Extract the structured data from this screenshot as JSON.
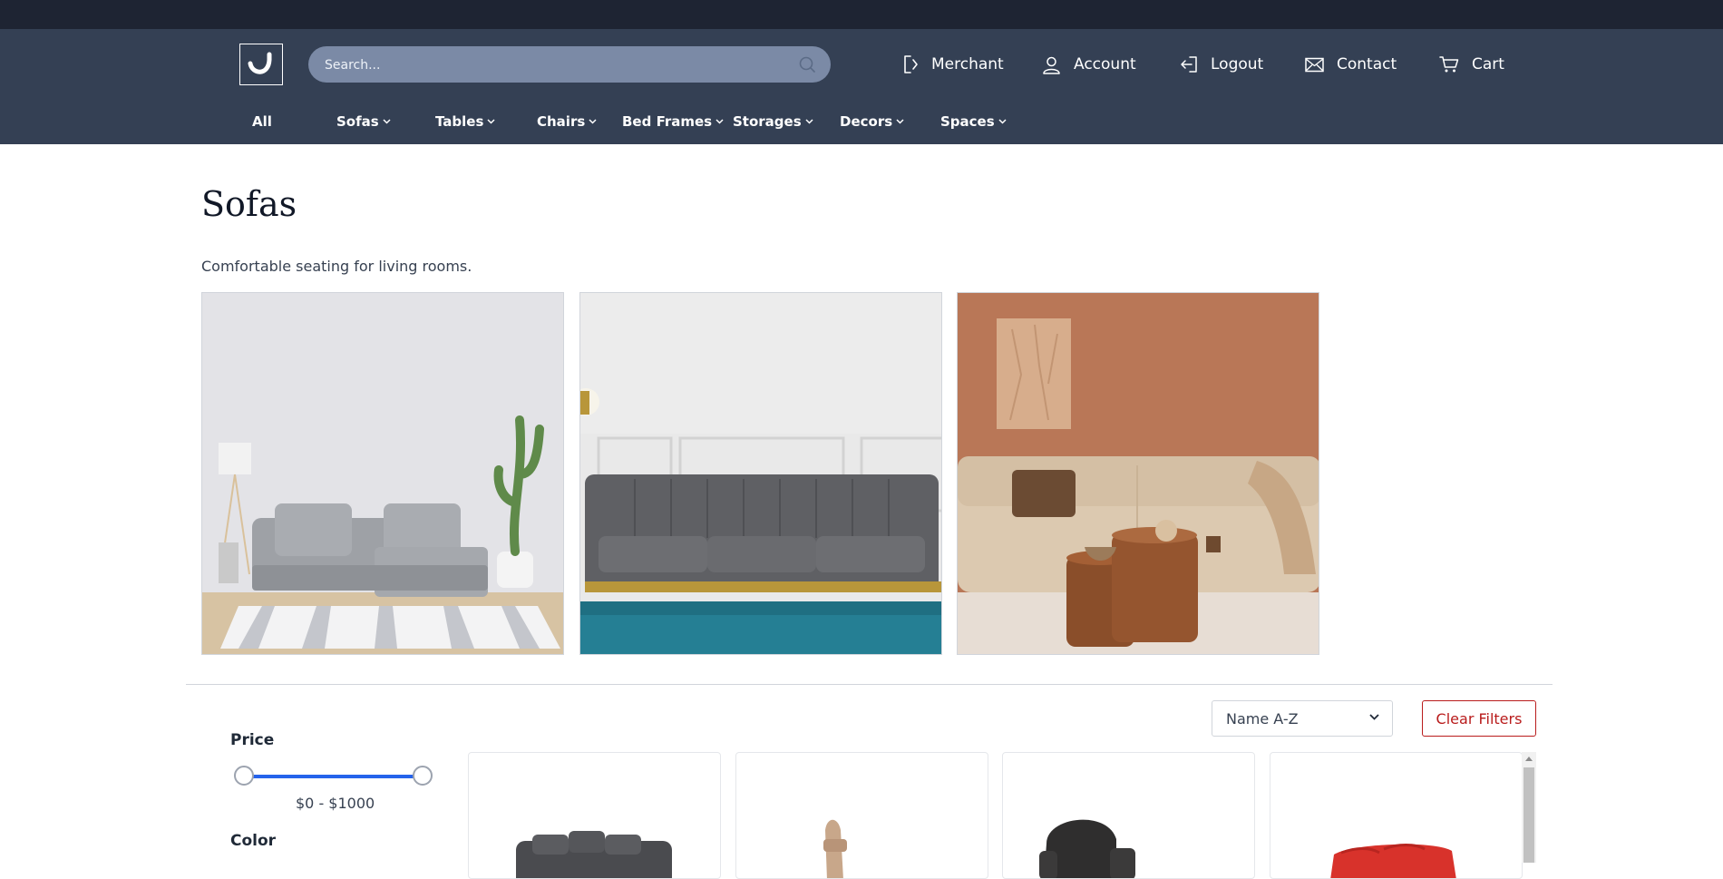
{
  "header": {
    "logo_alt": "J",
    "search": {
      "placeholder": "Search..."
    },
    "links": [
      {
        "label": "Merchant",
        "icon": "merchant-icon"
      },
      {
        "label": "Account",
        "icon": "user-icon"
      },
      {
        "label": "Logout",
        "icon": "logout-icon"
      },
      {
        "label": "Contact",
        "icon": "mail-icon"
      },
      {
        "label": "Cart",
        "icon": "cart-icon"
      }
    ]
  },
  "categories": [
    {
      "label": "All",
      "dropdown": false
    },
    {
      "label": "Sofas",
      "dropdown": true
    },
    {
      "label": "Tables",
      "dropdown": true
    },
    {
      "label": "Chairs",
      "dropdown": true
    },
    {
      "label": "Bed Frames",
      "dropdown": true
    },
    {
      "label": "Storages",
      "dropdown": true
    },
    {
      "label": "Decors",
      "dropdown": true
    },
    {
      "label": "Spaces",
      "dropdown": true
    }
  ],
  "page": {
    "title": "Sofas",
    "description": "Comfortable seating for living rooms."
  },
  "hero_images": [
    {
      "name": "grey-sofa-room-image",
      "bg": "#e4e5e9"
    },
    {
      "name": "velvet-sofa-image",
      "bg": "#ececec"
    },
    {
      "name": "beige-sofa-terracotta-image",
      "bg": "#b87558"
    }
  ],
  "toolbar": {
    "sort_selected": "Name A-Z",
    "clear_filters": "Clear Filters"
  },
  "filters": {
    "price_label": "Price",
    "price_min": 0,
    "price_max": 1000,
    "price_range_text": "$0 - $1000",
    "color_label": "Color"
  },
  "products": [
    {
      "name": "grey-sectional-product-image"
    },
    {
      "name": "office-chair-product-image"
    },
    {
      "name": "leather-recliner-product-image"
    },
    {
      "name": "red-leather-sofa-product-image"
    }
  ],
  "colors": {
    "topstrip": "#1e2433",
    "header": "#344054",
    "search_bg": "#7b8aa6",
    "accent_blue": "#2563eb",
    "danger": "#b91c1c"
  }
}
